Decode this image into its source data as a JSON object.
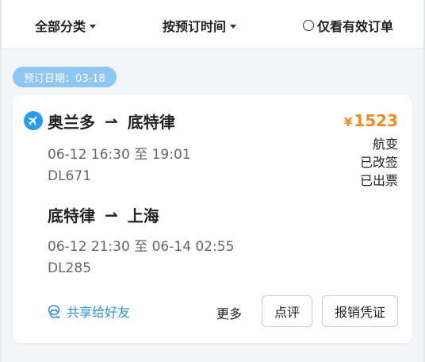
{
  "filters": {
    "category": "全部分类",
    "sort": "按预订时间",
    "valid_only": "仅看有效订单"
  },
  "booking_date_label": "预订日期：03-18",
  "order": {
    "price_currency": "¥",
    "price": "1523",
    "statuses": [
      "航变",
      "已改签",
      "已出票"
    ],
    "segments": [
      {
        "from": "奥兰多",
        "to": "底特律",
        "arrow": "⇀",
        "depart": "06-12 16:30",
        "sep": "至",
        "arrive": "19:01",
        "flight_no": "DL671"
      },
      {
        "from": "底特律",
        "to": "上海",
        "arrow": "⇀",
        "depart": "06-12 21:30",
        "sep": "至",
        "arrive": "06-14 02:55",
        "flight_no": "DL285"
      }
    ],
    "actions": {
      "share": "共享给好友",
      "more": "更多",
      "review": "点评",
      "reimburse": "报销凭证"
    }
  },
  "colors": {
    "accent_blue": "#2a9cf0",
    "price_orange": "#f08a24",
    "tag_blue": "#8ec7f2"
  },
  "icons": {
    "category_caret": "chevron-down-icon",
    "sort_caret": "chevron-down-icon",
    "airline": "plane-icon",
    "share": "chat-icon"
  }
}
